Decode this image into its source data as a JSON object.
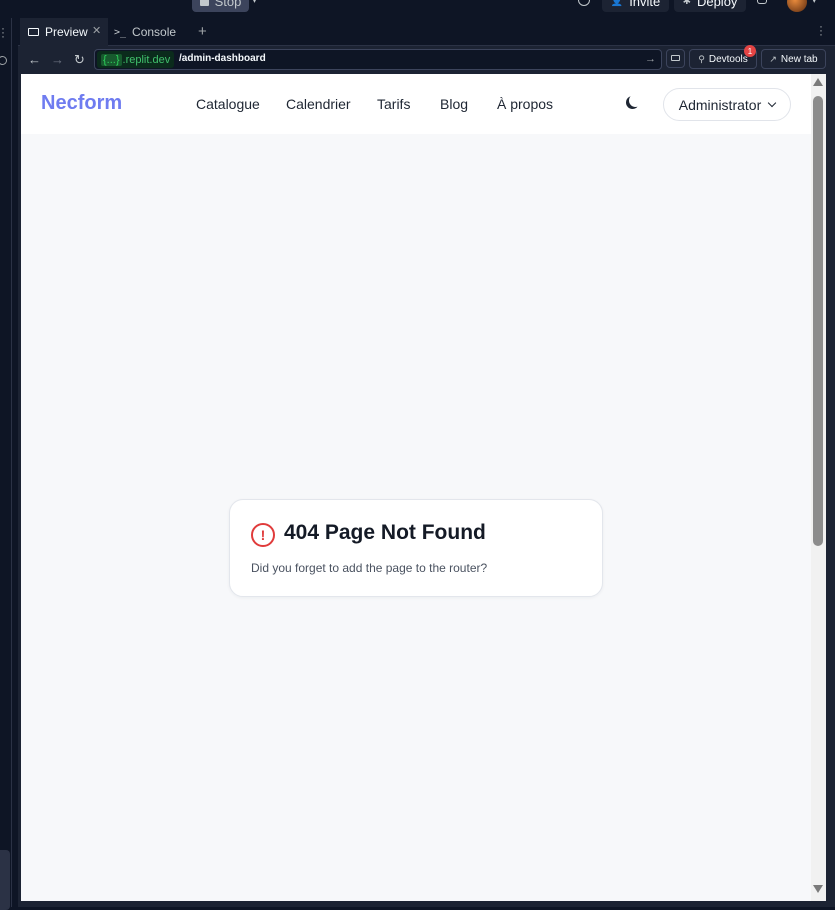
{
  "ide": {
    "stop_label": "Stop",
    "invite_label": "Invite",
    "deploy_label": "Deploy",
    "icons": [
      "search-icon",
      "bell-icon",
      "avatar",
      "monitor-icon",
      "console-icon",
      "devtools-icon",
      "external-link-icon"
    ]
  },
  "tabs": [
    {
      "label": "Preview",
      "active": true
    },
    {
      "label": "Console",
      "active": false
    }
  ],
  "urlbar": {
    "host_brace": "{...}",
    "host": ".replit.dev",
    "path": "/admin-dashboard",
    "devtools_label": "Devtools",
    "devtools_badge": "1",
    "newtab_label": "New tab"
  },
  "app": {
    "brand": "Necform",
    "nav": [
      "Catalogue",
      "Calendrier",
      "Tarifs",
      "Blog",
      "À propos"
    ],
    "user_menu_label": "Administrator",
    "brand_color": "#6f7cf0"
  },
  "error": {
    "title": "404 Page Not Found",
    "message": "Did you forget to add the page to the router?",
    "icon_color": "#e03b3b"
  }
}
